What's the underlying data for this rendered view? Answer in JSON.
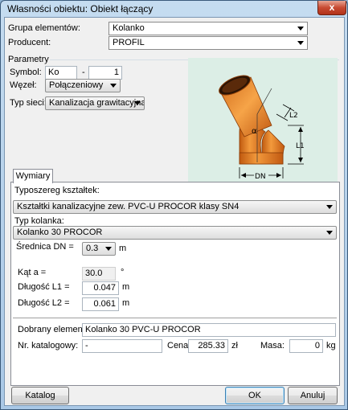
{
  "window": {
    "title": "Własności obiektu: Obiekt łączący",
    "close_glyph": "x"
  },
  "grupa": {
    "label": "Grupa elementów:",
    "value": "Kolanko"
  },
  "producent": {
    "label": "Producent:",
    "value": "PROFIL"
  },
  "parametry": {
    "group_label": "Parametry",
    "symbol": {
      "label": "Symbol:",
      "value1": "Ko",
      "dash": "-",
      "value2": "1"
    },
    "wezel": {
      "label": "Węzeł:",
      "value": "Połączeniowy"
    },
    "typ_sieci": {
      "label": "Typ sieci:",
      "value": "Kanalizacja grawitacyjna"
    }
  },
  "diagram": {
    "icon": "elbow-pipe-diagram",
    "alpha": "α",
    "l1": "L1",
    "l2": "L2",
    "dn": "DN"
  },
  "tabs": [
    {
      "label": "Wymiary"
    }
  ],
  "wymiary": {
    "typoszereg": {
      "label": "Typoszereg kształtek:",
      "value": "Kształtki kanalizacyjne zew. PVC-U PROCOR klasy SN4"
    },
    "typ_kolanka": {
      "label": "Typ kolanka:",
      "value": "Kolanko 30 PROCOR"
    },
    "srednica": {
      "label": "Średnica DN =",
      "value": "0.3",
      "unit": "m"
    },
    "kat": {
      "label": "Kąt a =",
      "value": "30.0",
      "unit": "°"
    },
    "l1": {
      "label": "Długość L1 =",
      "value": "0.047",
      "unit": "m"
    },
    "l2": {
      "label": "Długość L2 =",
      "value": "0.061",
      "unit": "m"
    },
    "dobrany": {
      "label": "Dobrany element:",
      "value": "Kolanko 30 PVC-U PROCOR"
    },
    "nr_katalogowy": {
      "label": "Nr. katalogowy:",
      "value": "-"
    },
    "cena": {
      "label": "Cena:",
      "value": "285.33",
      "unit": "zł"
    },
    "masa": {
      "label": "Masa:",
      "value": "0",
      "unit": "kg"
    }
  },
  "buttons": {
    "katalog": "Katalog",
    "ok": "OK",
    "anuluj": "Anuluj"
  }
}
